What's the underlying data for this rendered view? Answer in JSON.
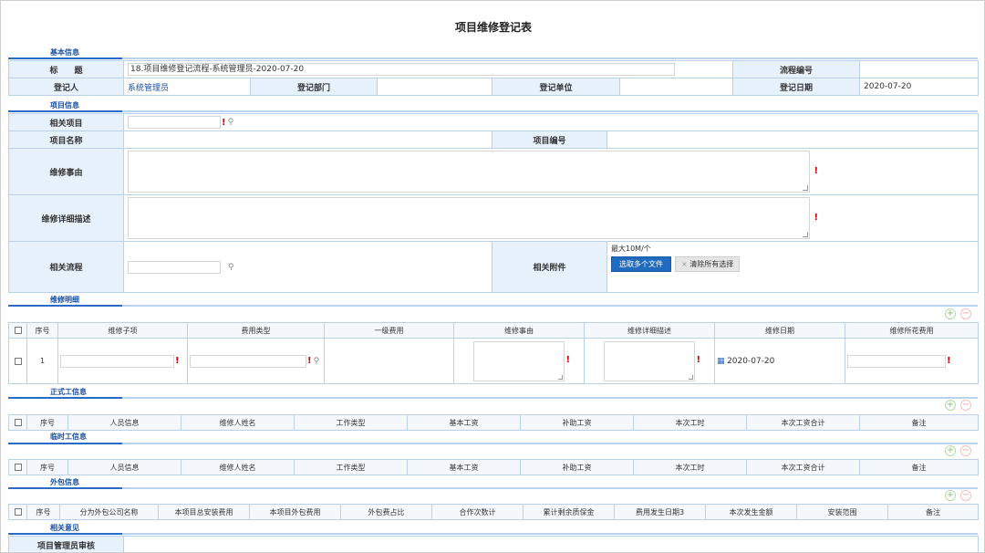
{
  "page_title": "项目维修登记表",
  "sections": {
    "basic": "基本信息",
    "project": "项目信息",
    "repair_detail": "维修明细",
    "formal": "正式工信息",
    "temp": "临时工信息",
    "outsource": "外包信息",
    "opinion": "相关意见"
  },
  "basic": {
    "title_label": "标　　题",
    "title_value": "18.项目维修登记流程-系统管理员-2020-07-20",
    "flow_no_label": "流程编号",
    "flow_no_value": "",
    "registrant_label": "登记人",
    "registrant_value": "系统管理员",
    "dept_label": "登记部门",
    "dept_value": "",
    "unit_label": "登记单位",
    "unit_value": "",
    "date_label": "登记日期",
    "date_value": "2020-07-20"
  },
  "project": {
    "related_project_label": "相关项目",
    "project_name_label": "项目名称",
    "project_no_label": "项目编号",
    "repair_reason_label": "维修事由",
    "repair_desc_label": "维修详细描述",
    "related_flow_label": "相关流程",
    "attachment_label": "相关附件",
    "attach_limit": "最大10M/个",
    "select_files_button": "选取多个文件",
    "clear_button": "清除所有选择",
    "clear_x": "×"
  },
  "repair_table": {
    "headers": [
      "序号",
      "维修子项",
      "费用类型",
      "一级费用",
      "维修事由",
      "维修详细描述",
      "维修日期",
      "维修所花费用"
    ],
    "row": {
      "index": "1",
      "date": "2020-07-20"
    }
  },
  "formal_table": {
    "headers": [
      "序号",
      "人员信息",
      "维修人姓名",
      "工作类型",
      "基本工资",
      "补助工资",
      "本次工时",
      "本次工资合计",
      "备注"
    ]
  },
  "temp_table": {
    "headers": [
      "序号",
      "人员信息",
      "维修人姓名",
      "工作类型",
      "基本工资",
      "补助工资",
      "本次工时",
      "本次工资合计",
      "备注"
    ]
  },
  "outsource_table": {
    "headers": [
      "序号",
      "分为外包公司名称",
      "本项目总安装费用",
      "本项目外包费用",
      "外包费占比",
      "合作次数计",
      "累计剩余质保金",
      "费用发生日期3",
      "本次发生金额",
      "安装范围",
      "备注"
    ]
  },
  "opinion": {
    "pm_review_label": "项目管理员审核"
  },
  "controls": {
    "add_symbol": "+",
    "remove_symbol": "−",
    "required_mark": "!",
    "search_symbol": "⚲",
    "calendar_symbol": "▦"
  }
}
